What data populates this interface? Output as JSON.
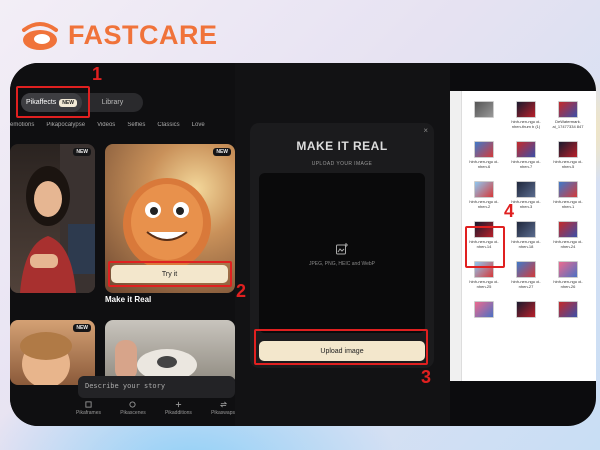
{
  "brand": {
    "name": "FASTCARE"
  },
  "pika": {
    "tabs": [
      {
        "label": "Pikaffects",
        "badge": "NEW"
      },
      {
        "label": "Library"
      }
    ],
    "categories": [
      "emotions",
      "Pikapocalypse",
      "Videos",
      "Selfies",
      "Classics",
      "Love"
    ],
    "card_badge": "NEW",
    "featured_card": {
      "title": "Make it Real",
      "button": "Try it"
    },
    "prompt_placeholder": "Describe your story",
    "nav": [
      "Pikaframes",
      "Pikascenes",
      "Pikadditions",
      "Pikaswaps"
    ]
  },
  "dialog": {
    "title": "MAKE IT REAL",
    "subtitle": "UPLOAD YOUR IMAGE",
    "formats": "JPEG, PNG, HEIC and WebP",
    "upload_button": "Upload image"
  },
  "files": {
    "items": [
      {
        "name": "",
        "thumb": "t-gray"
      },
      {
        "name": "hinh-nen-ngu oi-nhen-thum b (1)",
        "thumb": "t-dark"
      },
      {
        "name": "DeWatermark. ai_17477334 847",
        "thumb": "t-red"
      },
      {
        "name": "hinh-nen-ngu oi-nhen-6",
        "thumb": "t-blue"
      },
      {
        "name": "hinh-nen-ngu oi-nhen-7",
        "thumb": "t-red"
      },
      {
        "name": "hinh-nen-ngu oi-nhen-5",
        "thumb": "t-dark"
      },
      {
        "name": "hinh-nen-ngu oi-nhen-2",
        "thumb": "t-sky"
      },
      {
        "name": "hinh-nen-ngu oi-nhen-3",
        "thumb": "t-night"
      },
      {
        "name": "hinh-nen-ngu oi-nhen-1",
        "thumb": "t-blue"
      },
      {
        "name": "hinh-nen-ngu oi-nhen-14",
        "thumb": "t-dark"
      },
      {
        "name": "hinh-nen-ngu oi-nhen-18",
        "thumb": "t-night"
      },
      {
        "name": "hinh-nen-ngu oi-nhen-24",
        "thumb": "t-red"
      },
      {
        "name": "hinh-nen-ngu oi-nhen-25",
        "thumb": "t-sky"
      },
      {
        "name": "hinh-nen-ngu oi-nhen-27",
        "thumb": "t-blue"
      },
      {
        "name": "hinh-nen-ngu oi-nhen-26",
        "thumb": "t-pink"
      },
      {
        "name": "",
        "thumb": "t-pink"
      },
      {
        "name": "",
        "thumb": "t-dark"
      },
      {
        "name": "",
        "thumb": "t-red"
      }
    ]
  },
  "step_numbers": [
    "1",
    "2",
    "3",
    "4"
  ],
  "colors": {
    "brand_orange": "#f0733a",
    "highlight_red": "#e02020",
    "button_cream": "#f3e7cc"
  }
}
